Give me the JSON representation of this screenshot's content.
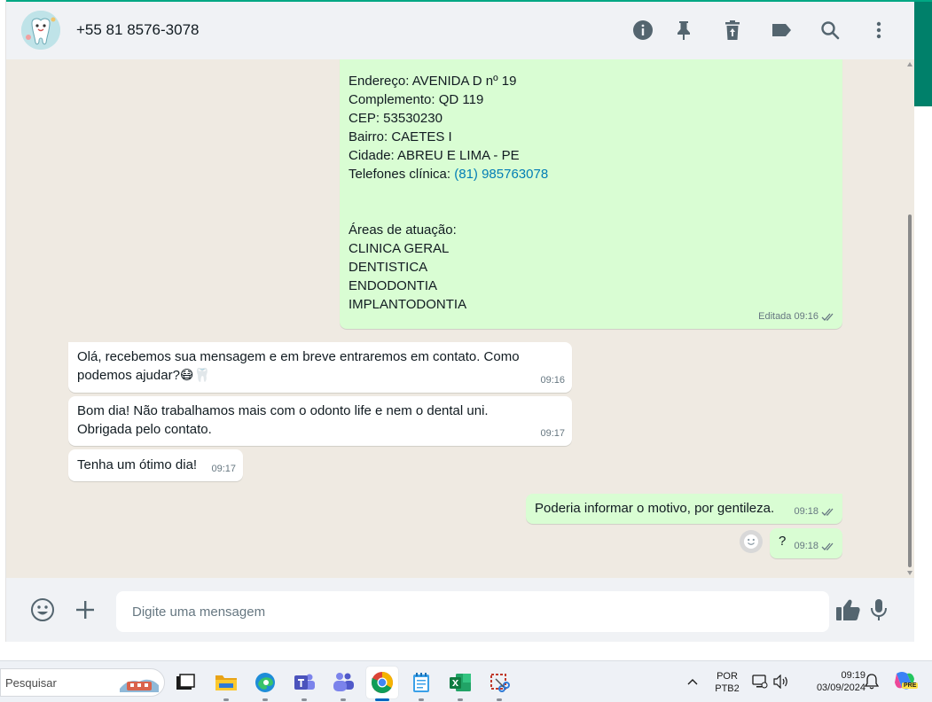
{
  "header": {
    "contact_name": "+55 81 8576-3078",
    "icons": [
      "info-icon",
      "pin-icon",
      "archive-icon",
      "label-icon",
      "search-icon",
      "more-options-icon"
    ]
  },
  "messages": {
    "clinic_info": {
      "lines": [
        "Endereço: AVENIDA D nº 19",
        "Complemento: QD 119",
        "CEP: 53530230",
        "Bairro: CAETES I",
        "Cidade: ABREU E LIMA - PE"
      ],
      "phone_label": "Telefones clínica: ",
      "phone_link": "(81) 985763078",
      "areas_title": "Áreas de atuação:",
      "areas": [
        "CLINICA GERAL",
        "DENTISTICA",
        "ENDODONTIA",
        "IMPLANTODONTIA"
      ],
      "meta": "Editada 09:16"
    },
    "incoming": [
      {
        "line1": "Olá, recebemos sua mensagem e em breve entraremos em contato. Como",
        "line2": "podemos ajudar?😷🦷",
        "time": "09:16"
      },
      {
        "line1": "Bom dia! Não trabalhamos mais com o odonto life e nem o dental uni.",
        "line2": "Obrigada pelo contato.",
        "time": "09:17"
      },
      {
        "line1": "Tenha um ótimo dia!",
        "time": "09:17"
      }
    ],
    "outgoing": [
      {
        "text": "Poderia informar o motivo, por gentileza.",
        "time": "09:18"
      },
      {
        "text": "?",
        "time": "09:18"
      }
    ]
  },
  "composer": {
    "placeholder": "Digite uma mensagem"
  },
  "taskbar": {
    "search_placeholder": "Pesquisar",
    "language_line1": "POR",
    "language_line2": "PTB2",
    "time": "09:19",
    "date": "03/09/2024",
    "copilot_badge": "PRE"
  },
  "colors": {
    "accent": "#00a884",
    "incoming_bubble": "#ffffff",
    "outgoing_bubble": "#d9fdd3",
    "link": "#027eb5",
    "read_ticks": "#667781"
  }
}
